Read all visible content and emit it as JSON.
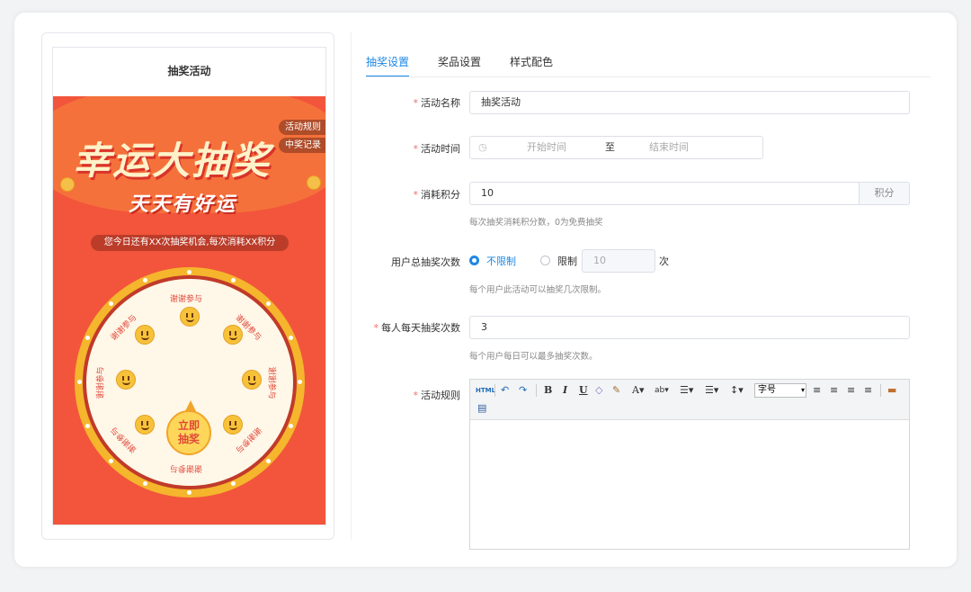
{
  "preview": {
    "header_title": "抽奖活动",
    "title_main": "幸运大抽奖",
    "title_sub": "天天有好运",
    "rules_button": "活动规则",
    "records_button": "中奖记录",
    "chance_text": "您今日还有XX次抽奖机会,每次消耗XX积分",
    "start_button_line1": "立即",
    "start_button_line2": "抽奖",
    "prize_label": "谢谢参与"
  },
  "tabs": [
    {
      "label": "抽奖设置",
      "active": true
    },
    {
      "label": "奖品设置",
      "active": false
    },
    {
      "label": "样式配色",
      "active": false
    }
  ],
  "form": {
    "activity_name": {
      "label": "活动名称",
      "required": true,
      "value": "抽奖活动"
    },
    "activity_time": {
      "label": "活动时间",
      "required": true,
      "start_placeholder": "开始时间",
      "separator": "至",
      "end_placeholder": "结束时间"
    },
    "points_cost": {
      "label": "消耗积分",
      "required": true,
      "value": "10",
      "addon": "积分",
      "hint": "每次抽奖消耗积分数，0为免费抽奖"
    },
    "total_draws": {
      "label": "用户总抽奖次数",
      "required": false,
      "option_unlimited": "不限制",
      "option_limited": "限制",
      "selected": "不限制",
      "limit_value": "10",
      "unit": "次",
      "hint": "每个用户此活动可以抽奖几次限制。"
    },
    "daily_draws": {
      "label": "每人每天抽奖次数",
      "required": true,
      "value": "3",
      "hint": "每个用户每日可以最多抽奖次数。"
    },
    "rules": {
      "label": "活动规则",
      "required": true
    }
  },
  "editor": {
    "html_label": "HTML",
    "bold": "B",
    "italic": "I",
    "underline": "U",
    "font_color": "A",
    "font_size_label": "字号"
  }
}
